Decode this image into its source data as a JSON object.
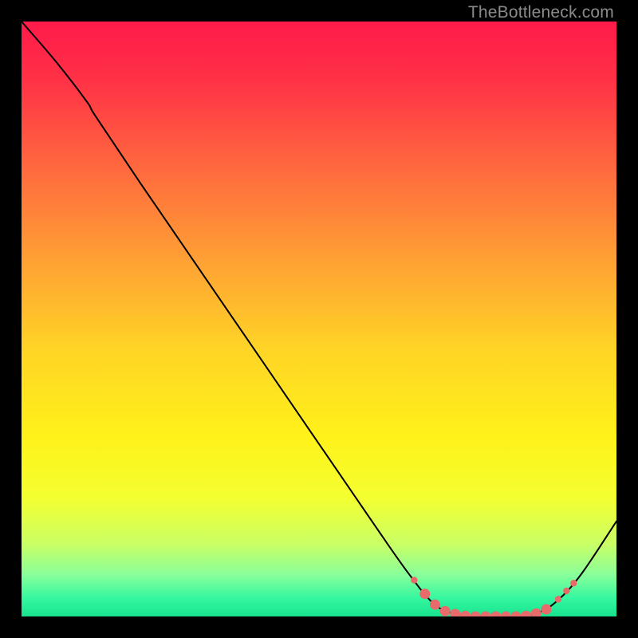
{
  "watermark": "TheBottleneck.com",
  "chart_data": {
    "type": "line",
    "title": "",
    "xlabel": "",
    "ylabel": "",
    "xlim": [
      0,
      100
    ],
    "ylim": [
      0,
      100
    ],
    "grid": false,
    "legend": false,
    "background_gradient": {
      "stops": [
        {
          "offset": 0.0,
          "color": "#ff1a4a"
        },
        {
          "offset": 0.1,
          "color": "#ff3246"
        },
        {
          "offset": 0.25,
          "color": "#ff6a3e"
        },
        {
          "offset": 0.4,
          "color": "#ffa034"
        },
        {
          "offset": 0.55,
          "color": "#ffd426"
        },
        {
          "offset": 0.7,
          "color": "#fff21a"
        },
        {
          "offset": 0.8,
          "color": "#f4ff30"
        },
        {
          "offset": 0.88,
          "color": "#c8ff66"
        },
        {
          "offset": 0.93,
          "color": "#88ff9a"
        },
        {
          "offset": 0.97,
          "color": "#34f7a0"
        },
        {
          "offset": 1.0,
          "color": "#18e28e"
        }
      ]
    },
    "series": [
      {
        "name": "curve",
        "stroke": "#000000",
        "stroke_width": 2,
        "points": [
          {
            "x": 0.0,
            "y": 100.0
          },
          {
            "x": 6.0,
            "y": 93.0
          },
          {
            "x": 11.0,
            "y": 86.5
          },
          {
            "x": 12.5,
            "y": 84.0
          },
          {
            "x": 20.0,
            "y": 72.8
          },
          {
            "x": 30.0,
            "y": 58.2
          },
          {
            "x": 40.0,
            "y": 43.6
          },
          {
            "x": 50.0,
            "y": 29.0
          },
          {
            "x": 60.0,
            "y": 14.4
          },
          {
            "x": 65.0,
            "y": 7.3
          },
          {
            "x": 69.0,
            "y": 2.4
          },
          {
            "x": 72.0,
            "y": 0.7
          },
          {
            "x": 76.0,
            "y": 0.0
          },
          {
            "x": 80.0,
            "y": 0.0
          },
          {
            "x": 84.0,
            "y": 0.0
          },
          {
            "x": 87.0,
            "y": 0.7
          },
          {
            "x": 90.0,
            "y": 2.6
          },
          {
            "x": 94.0,
            "y": 7.0
          },
          {
            "x": 100.0,
            "y": 16.0
          }
        ]
      }
    ],
    "markers": {
      "name": "highlight-dots",
      "fill": "#e86a6a",
      "points": [
        {
          "x": 66.0,
          "y": 6.1,
          "r": 4.2
        },
        {
          "x": 67.8,
          "y": 3.8,
          "r": 6.5
        },
        {
          "x": 69.5,
          "y": 2.0,
          "r": 6.5
        },
        {
          "x": 71.2,
          "y": 0.9,
          "r": 6.5
        },
        {
          "x": 72.9,
          "y": 0.4,
          "r": 6.5
        },
        {
          "x": 74.6,
          "y": 0.1,
          "r": 6.5
        },
        {
          "x": 76.3,
          "y": 0.0,
          "r": 6.5
        },
        {
          "x": 78.0,
          "y": 0.0,
          "r": 6.5
        },
        {
          "x": 79.7,
          "y": 0.0,
          "r": 6.5
        },
        {
          "x": 81.4,
          "y": 0.0,
          "r": 6.5
        },
        {
          "x": 83.1,
          "y": 0.0,
          "r": 6.5
        },
        {
          "x": 84.8,
          "y": 0.1,
          "r": 6.5
        },
        {
          "x": 86.5,
          "y": 0.5,
          "r": 6.5
        },
        {
          "x": 88.2,
          "y": 1.2,
          "r": 6.5
        },
        {
          "x": 90.2,
          "y": 2.9,
          "r": 4.2
        },
        {
          "x": 91.6,
          "y": 4.3,
          "r": 4.2
        },
        {
          "x": 92.8,
          "y": 5.6,
          "r": 4.2
        }
      ]
    }
  }
}
